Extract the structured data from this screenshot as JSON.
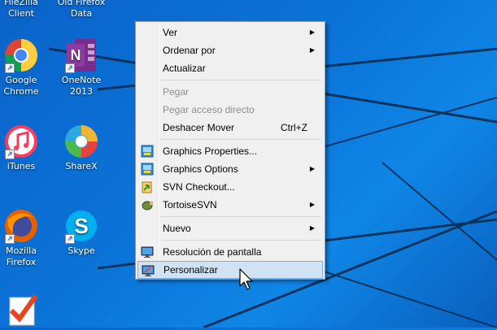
{
  "desktop": {
    "icons": [
      {
        "label1": "FileZilla",
        "label2": "Client"
      },
      {
        "label1": "Old Firefox",
        "label2": "Data"
      },
      {
        "label1": "Google",
        "label2": "Chrome"
      },
      {
        "label1": "OneNote",
        "label2": "2013"
      },
      {
        "label1": "iTunes",
        "label2": ""
      },
      {
        "label1": "ShareX",
        "label2": ""
      },
      {
        "label1": "Mozilla",
        "label2": "Firefox"
      },
      {
        "label1": "Skype",
        "label2": ""
      }
    ]
  },
  "context_menu": {
    "items": [
      {
        "label": "Ver"
      },
      {
        "label": "Ordenar por"
      },
      {
        "label": "Actualizar"
      },
      {
        "label": "Pegar"
      },
      {
        "label": "Pegar acceso directo"
      },
      {
        "label": "Deshacer Mover",
        "shortcut": "Ctrl+Z"
      },
      {
        "label": "Graphics Properties..."
      },
      {
        "label": "Graphics Options"
      },
      {
        "label": "SVN Checkout..."
      },
      {
        "label": "TortoiseSVN"
      },
      {
        "label": "Nuevo"
      },
      {
        "label": "Resolución de pantalla"
      },
      {
        "label": "Personalizar"
      }
    ]
  },
  "colors": {
    "desktop_bg": "#0b74d8",
    "menu_bg": "#f0f0f0",
    "hover_bg": "#d1e2f2",
    "hover_border": "#78aee5"
  }
}
